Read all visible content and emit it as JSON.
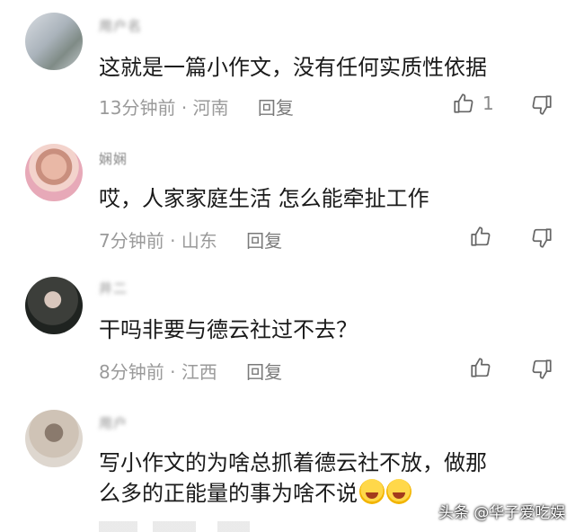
{
  "comments": [
    {
      "username": "用户名",
      "text": "这就是一篇小作文，没有任何实质性依据",
      "time": "13分钟前",
      "location": "河南",
      "reply_label": "回复",
      "like_count": "1",
      "like_icon": "thumbs-up-icon",
      "dislike_icon": "thumbs-down-icon"
    },
    {
      "username": "娴娴",
      "text": "哎，人家家庭生活 怎么能牵扯工作",
      "time": "7分钟前",
      "location": "山东",
      "reply_label": "回复",
      "like_count": "",
      "like_icon": "thumbs-up-icon",
      "dislike_icon": "thumbs-down-icon"
    },
    {
      "username": "井二",
      "text": "干吗非要与德云社过不去？",
      "time": "8分钟前",
      "location": "江西",
      "reply_label": "回复",
      "like_count": "",
      "like_icon": "thumbs-up-icon",
      "dislike_icon": "thumbs-down-icon"
    },
    {
      "username": "用户",
      "text_line1": "写小作文的为啥总抓着德云社不放，做那",
      "text_line2": "么多的正能量的事为啥不说",
      "emoji": "rolling-laughing-emoji"
    }
  ],
  "watermark": "头条 @华子爱吃娱"
}
